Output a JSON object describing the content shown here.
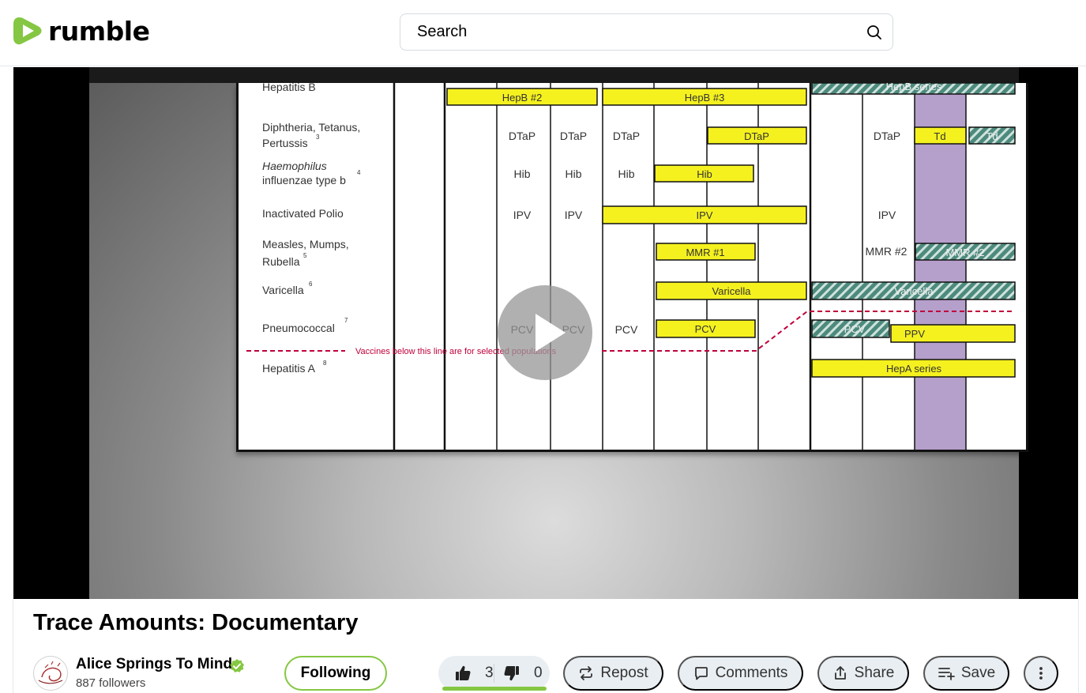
{
  "header": {
    "logo_text": "rumble",
    "search_placeholder": "Search"
  },
  "video": {
    "title": "Trace Amounts: Documentary",
    "slide": {
      "rows": [
        "Hepatitis B",
        "Diphtheria, Tetanus,",
        "Pertussis",
        "Haemophilus",
        "influenzae type b",
        "Inactivated Polio",
        "Measles, Mumps,",
        "Rubella",
        "Varicella",
        "Pneumococcal",
        "Hepatitis A"
      ],
      "footnotes": [
        "3",
        "4",
        "5",
        "6",
        "7",
        "8"
      ],
      "cells": {
        "dtap1": "DTaP",
        "dtap2": "DTaP",
        "dtap3": "DTaP",
        "dtap4": "DTaP",
        "hib1": "Hib",
        "hib2": "Hib",
        "hib3": "Hib",
        "ipv1": "IPV",
        "ipv2": "IPV",
        "ipv3": "IPV",
        "pcv1": "PCV",
        "pcv2": "PCV",
        "pcv3": "PCV",
        "mmr2": "MMR #2"
      },
      "bars": {
        "hepb2": "HepB #2",
        "hepb3": "HepB #3",
        "dtap": "DTaP",
        "td": "Td",
        "td_catchup": "Td",
        "hib": "Hib",
        "ipv": "IPV",
        "mmr1": "MMR #1",
        "mmr_catchup": "MMR #2",
        "varicella": "Varicella",
        "varicella_catchup": "Varicella",
        "pcv": "PCV",
        "pcv_catchup": "PCV",
        "ppv": "PPV",
        "hepa": "HepA series",
        "hepb_catchup": "HepB series"
      },
      "divider_note": "Vaccines below this line are for selected populations"
    },
    "colors": {
      "bar_yellow": "#f5f11f",
      "catchup_hatch": "#4d8a7e",
      "adolescent_column": "#b59fcb",
      "divider_red": "#c0003a",
      "accent_green": "#85c742"
    }
  },
  "channel": {
    "name": "Alice Springs To Mind",
    "followers": "887 followers",
    "follow_label": "Following"
  },
  "actions": {
    "likes": "3",
    "dislikes": "0",
    "repost": "Repost",
    "comments": "Comments",
    "share": "Share",
    "save": "Save"
  }
}
